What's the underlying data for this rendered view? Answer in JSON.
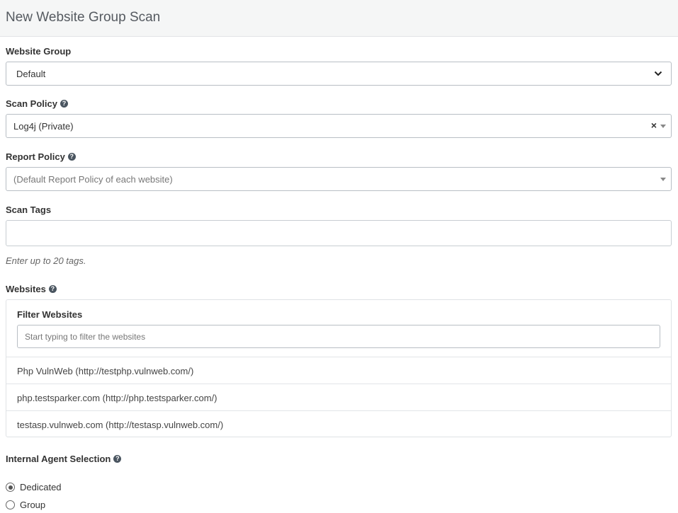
{
  "header": {
    "title": "New Website Group Scan"
  },
  "website_group": {
    "label": "Website Group",
    "selected": "Default"
  },
  "scan_policy": {
    "label": "Scan Policy",
    "selected": "Log4j (Private)",
    "clear_glyph": "×"
  },
  "report_policy": {
    "label": "Report Policy",
    "placeholder": "(Default Report Policy of each website)"
  },
  "scan_tags": {
    "label": "Scan Tags",
    "value": "",
    "hint": "Enter up to 20 tags."
  },
  "websites": {
    "label": "Websites",
    "filter_label": "Filter Websites",
    "filter_placeholder": "Start typing to filter the websites",
    "items": [
      {
        "name": "Php VulnWeb (http://testphp.vulnweb.com/)"
      },
      {
        "name": "php.testsparker.com (http://php.testsparker.com/)"
      },
      {
        "name": "testasp.vulnweb.com (http://testasp.vulnweb.com/)"
      }
    ]
  },
  "internal_agent": {
    "label": "Internal Agent Selection",
    "options": [
      {
        "label": "Dedicated",
        "checked": true
      },
      {
        "label": "Group",
        "checked": false
      }
    ]
  },
  "icons": {
    "help": "question-circle-icon",
    "dropdown": "chevron-down-icon",
    "caret": "caret-down-icon"
  },
  "colors": {
    "header_bg": "#f5f6f6",
    "border": "#b8bec4",
    "text": "#333333",
    "help_icon": "#4a5560"
  }
}
